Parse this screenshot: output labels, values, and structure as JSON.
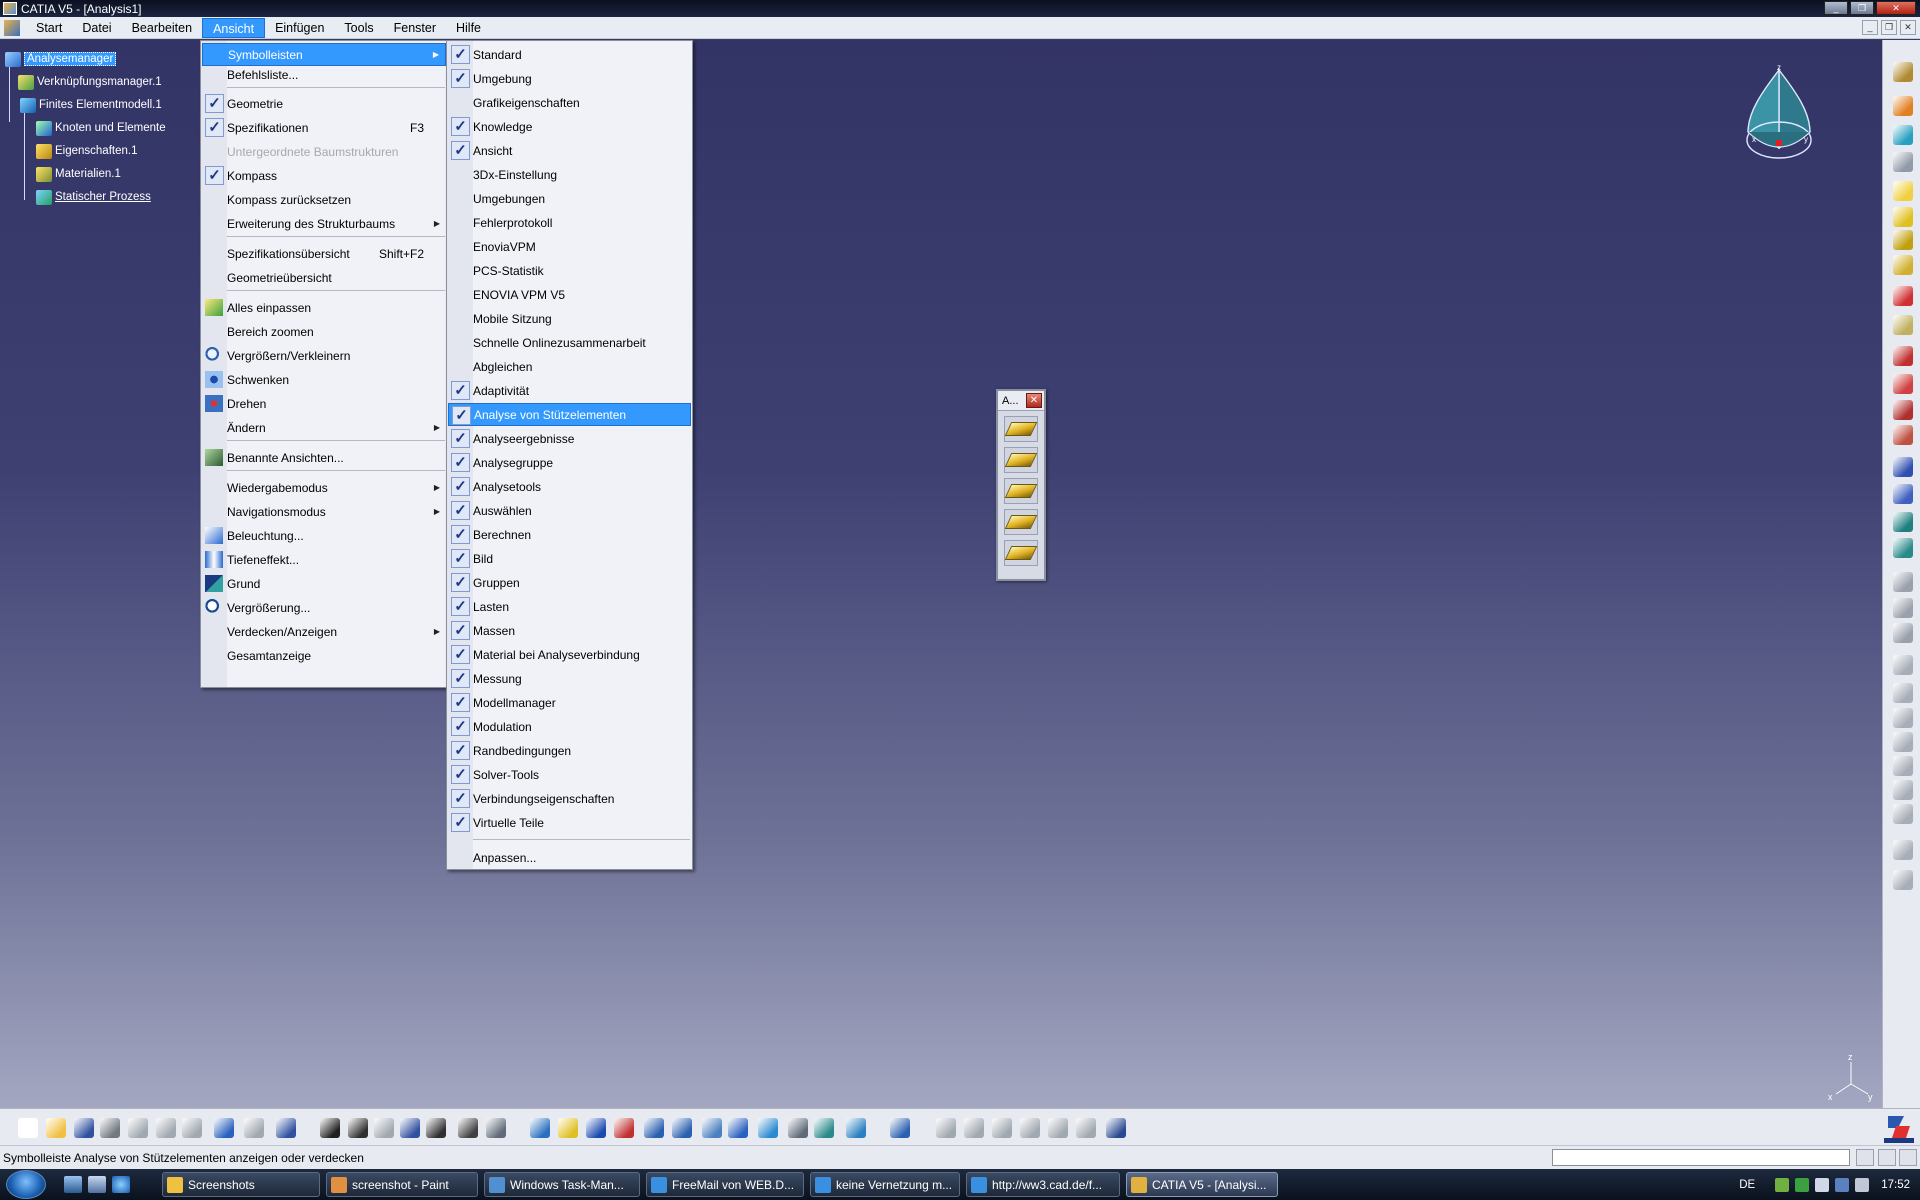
{
  "window": {
    "title": "CATIA V5 - [Analysis1]"
  },
  "menubar": {
    "items": [
      "Start",
      "Datei",
      "Bearbeiten",
      "Ansicht",
      "Einfügen",
      "Tools",
      "Fenster",
      "Hilfe"
    ],
    "active": "Ansicht"
  },
  "spec_tree": {
    "root": "Analysemanager",
    "links": "Verknüpfungsmanager.1",
    "fem": "Finites Elementmodell.1",
    "nodes": "Knoten und Elemente",
    "properties": "Eigenschaften.1",
    "materials": "Materialien.1",
    "process": "Statischer Prozess"
  },
  "ansicht_menu": {
    "items": [
      {
        "label": "Symbolleisten",
        "submenu": true,
        "highlight": true
      },
      {
        "label": "Befehlsliste..."
      },
      {
        "label": "Geometrie",
        "checked": true
      },
      {
        "label": "Spezifikationen",
        "checked": true,
        "shortcut": "F3"
      },
      {
        "label": "Untergeordnete Baumstrukturen",
        "disabled": true
      },
      {
        "label": "Kompass",
        "checked": true
      },
      {
        "label": "Kompass zurücksetzen"
      },
      {
        "label": "Erweiterung des Strukturbaums",
        "submenu": true
      },
      {
        "label": "Spezifikationsübersicht",
        "shortcut": "Shift+F2"
      },
      {
        "label": "Geometrieübersicht"
      },
      {
        "label": "Alles einpassen",
        "icon": "fit-all-icon"
      },
      {
        "label": "Bereich zoomen"
      },
      {
        "label": "Vergrößern/Verkleinern",
        "icon": "zoom-icon"
      },
      {
        "label": "Schwenken",
        "icon": "pan-icon"
      },
      {
        "label": "Drehen",
        "icon": "rotate-icon"
      },
      {
        "label": "Ändern",
        "submenu": true
      },
      {
        "label": "Benannte Ansichten...",
        "icon": "named-views-icon"
      },
      {
        "label": "Wiedergabemodus",
        "submenu": true
      },
      {
        "label": "Navigationsmodus",
        "submenu": true
      },
      {
        "label": "Beleuchtung...",
        "icon": "lighting-icon"
      },
      {
        "label": "Tiefeneffekt...",
        "icon": "depth-effect-icon"
      },
      {
        "label": "Grund",
        "icon": "ground-icon"
      },
      {
        "label": "Vergrößerung...",
        "icon": "magnifier-icon"
      },
      {
        "label": "Verdecken/Anzeigen",
        "submenu": true
      },
      {
        "label": "Gesamtanzeige"
      }
    ]
  },
  "symbolleisten_menu": {
    "items": [
      {
        "label": "Standard",
        "checked": true
      },
      {
        "label": "Umgebung",
        "checked": true
      },
      {
        "label": "Grafikeigenschaften",
        "checked": false
      },
      {
        "label": "Knowledge",
        "checked": true
      },
      {
        "label": "Ansicht",
        "checked": true
      },
      {
        "label": "3Dx-Einstellung",
        "checked": false
      },
      {
        "label": "Umgebungen",
        "checked": false
      },
      {
        "label": "Fehlerprotokoll",
        "checked": false
      },
      {
        "label": "EnoviaVPM",
        "checked": false
      },
      {
        "label": "PCS-Statistik",
        "checked": false
      },
      {
        "label": "ENOVIA VPM V5",
        "checked": false
      },
      {
        "label": "Mobile Sitzung",
        "checked": false
      },
      {
        "label": "Schnelle Onlinezusammenarbeit",
        "checked": false
      },
      {
        "label": "Abgleichen",
        "checked": false
      },
      {
        "label": "Adaptivität",
        "checked": true
      },
      {
        "label": "Analyse von Stützelementen",
        "checked": true,
        "highlight": true
      },
      {
        "label": "Analyseergebnisse",
        "checked": true
      },
      {
        "label": "Analysegruppe",
        "checked": true
      },
      {
        "label": "Analysetools",
        "checked": true
      },
      {
        "label": "Auswählen",
        "checked": true
      },
      {
        "label": "Berechnen",
        "checked": true
      },
      {
        "label": "Bild",
        "checked": true
      },
      {
        "label": "Gruppen",
        "checked": true
      },
      {
        "label": "Lasten",
        "checked": true
      },
      {
        "label": "Massen",
        "checked": true
      },
      {
        "label": "Material bei Analyseverbindung",
        "checked": true
      },
      {
        "label": "Messung",
        "checked": true
      },
      {
        "label": "Modellmanager",
        "checked": true
      },
      {
        "label": "Modulation",
        "checked": true
      },
      {
        "label": "Randbedingungen",
        "checked": true
      },
      {
        "label": "Solver-Tools",
        "checked": true
      },
      {
        "label": "Verbindungseigenschaften",
        "checked": true
      },
      {
        "label": "Virtuelle Teile",
        "checked": true
      },
      {
        "label": "Anpassen...",
        "checked": false
      }
    ]
  },
  "floating_toolbar": {
    "title": "A...",
    "close": "✕"
  },
  "status": {
    "message": "Symbolleiste Analyse von Stützelementen anzeigen oder verdecken"
  },
  "taskbar": {
    "tasks": [
      {
        "label": "Screenshots",
        "active": false
      },
      {
        "label": "screenshot - Paint",
        "active": false
      },
      {
        "label": "Windows Task-Man...",
        "active": false
      },
      {
        "label": "FreeMail von WEB.D...",
        "active": false
      },
      {
        "label": "keine Vernetzung m...",
        "active": false
      },
      {
        "label": "http://ww3.cad.de/f...",
        "active": false
      },
      {
        "label": "CATIA V5 - [Analysi...",
        "active": true
      }
    ],
    "language": "DE",
    "clock": "17:52"
  },
  "compass": {
    "axes": [
      "z",
      "x",
      "y"
    ]
  },
  "axis_indicator": {
    "axes": [
      "z",
      "x",
      "y"
    ]
  },
  "colors": {
    "highlight": "#3399ff",
    "workspace_top": "#333466",
    "workspace_bottom": "#a4a7c1",
    "menu_bg": "#f1f2f7"
  }
}
